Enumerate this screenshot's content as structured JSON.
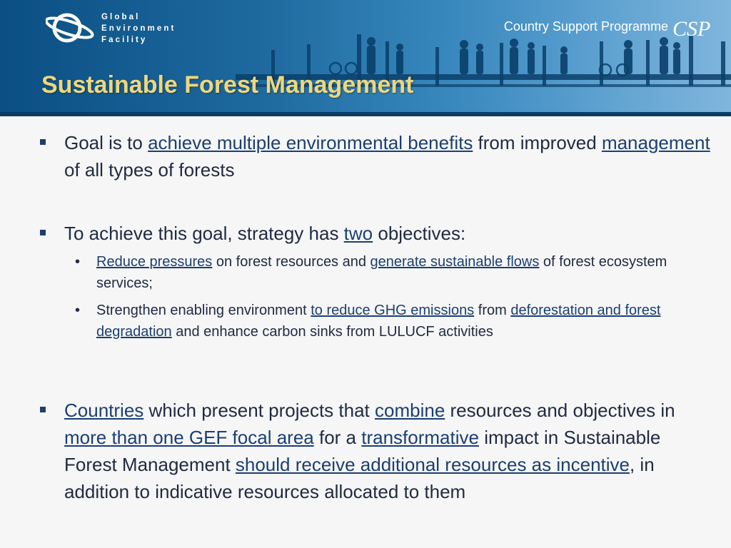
{
  "header": {
    "org_line1": "Global",
    "org_line2": "Environment",
    "org_line3": "Facility",
    "programme": "Country Support Programme",
    "programme_logo_text": "CSP",
    "title": "Sustainable Forest Management"
  },
  "bullets": {
    "b1": {
      "t1": "Goal is to ",
      "u1": "achieve multiple environmental benefits",
      "t2": " from improved ",
      "u2": "management",
      "t3": " of all types of forests"
    },
    "b2": {
      "t1": "To achieve this goal, strategy has ",
      "u1": "two",
      "t2": " objectives:",
      "s1": {
        "u1": "Reduce pressures",
        "t1": " on forest resources and ",
        "u2": "generate sustainable flows",
        "t2": " of forest ecosystem services;"
      },
      "s2": {
        "t1": "Strengthen enabling environment ",
        "u1": "to reduce GHG emissions",
        "t2": " from ",
        "u2": "deforestation and forest degradation",
        "t3": " and enhance carbon sinks from LULUCF activities"
      }
    },
    "b3": {
      "u1": "Countries",
      "t1": " which present projects that ",
      "u2": "combine",
      "t2": " resources and objectives in ",
      "u3": "more than one GEF focal area",
      "t3": " for a ",
      "u4": "transformative",
      "t4": " impact in Sustainable Forest Management ",
      "u5": "should receive additional resources as incentive",
      "t5": ", in addition to indicative resources allocated to them"
    }
  },
  "colors": {
    "banner": "#0f5f98",
    "title": "#f0d77a",
    "text": "#202b44",
    "link": "#1b3f72"
  }
}
